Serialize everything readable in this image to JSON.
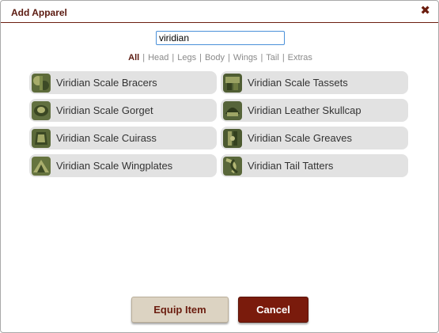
{
  "dialog": {
    "title": "Add Apparel",
    "close_glyph": "✖",
    "close_icon": "close-icon"
  },
  "search": {
    "value": "viridian"
  },
  "filters": [
    {
      "label": "All",
      "active": true
    },
    {
      "label": "Head",
      "active": false
    },
    {
      "label": "Legs",
      "active": false
    },
    {
      "label": "Body",
      "active": false
    },
    {
      "label": "Wings",
      "active": false
    },
    {
      "label": "Tail",
      "active": false
    },
    {
      "label": "Extras",
      "active": false
    }
  ],
  "items": [
    {
      "label": "Viridian Scale Bracers"
    },
    {
      "label": "Viridian Scale Tassets"
    },
    {
      "label": "Viridian Scale Gorget"
    },
    {
      "label": "Viridian Leather Skullcap"
    },
    {
      "label": "Viridian Scale Cuirass"
    },
    {
      "label": "Viridian Scale Greaves"
    },
    {
      "label": "Viridian Scale Wingplates"
    },
    {
      "label": "Viridian Tail Tatters"
    }
  ],
  "buttons": {
    "equip": "Equip Item",
    "cancel": "Cancel"
  },
  "colors": {
    "accent": "#6b1d0f",
    "cancel_bg": "#7a1b0c",
    "equip_bg": "#dcd3c2",
    "item_bg": "#e2e2e2"
  }
}
